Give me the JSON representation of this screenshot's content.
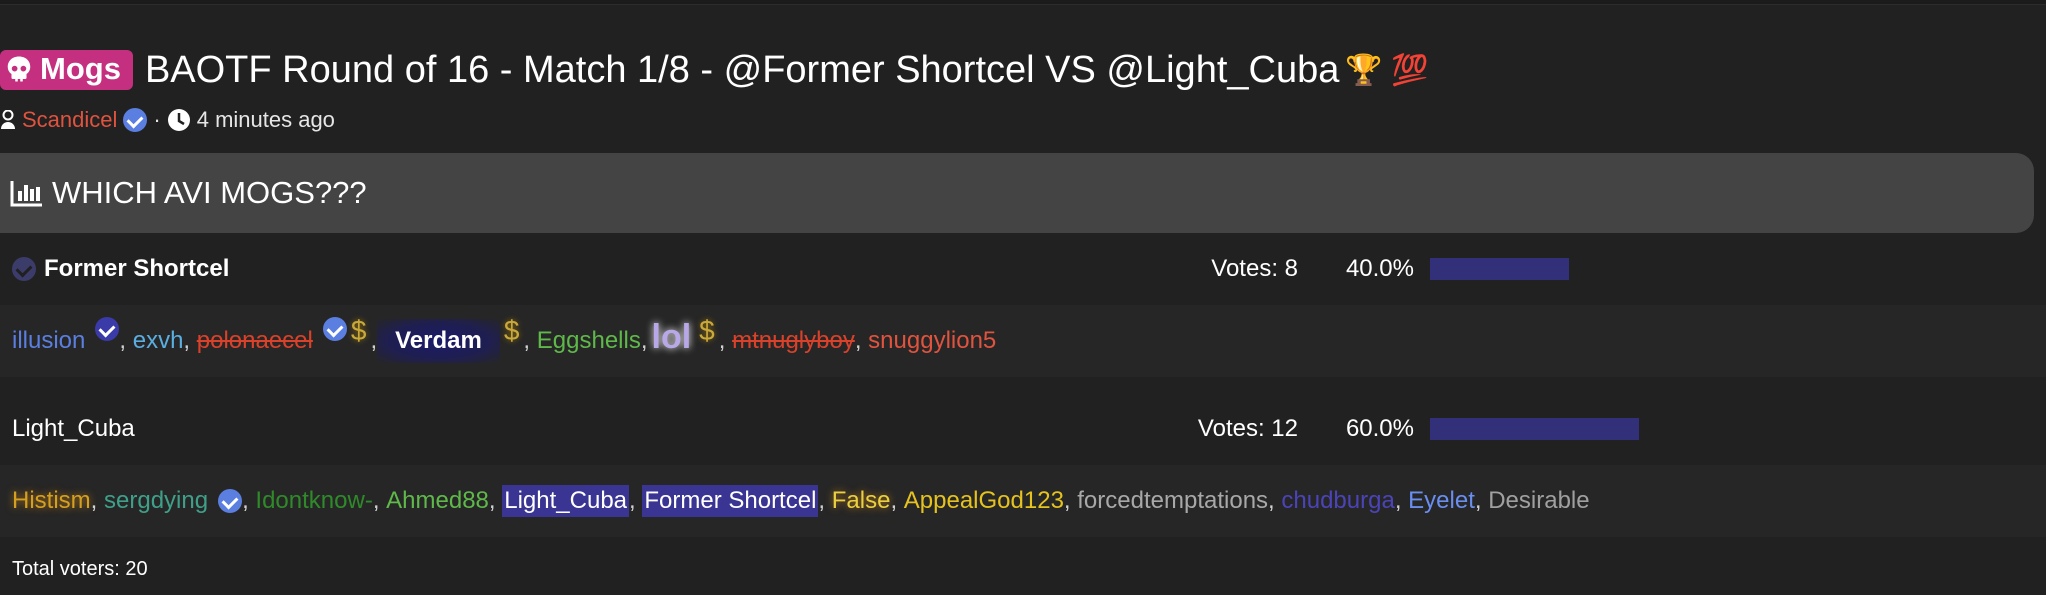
{
  "thread": {
    "tag_label": "Mogs",
    "title": "BAOTF Round of 16 - Match 1/8 - @Former Shortcel VS @Light_Cuba",
    "title_emojis": "🏆 💯",
    "author": "Scandicel",
    "separator": "·",
    "posted_ago": "4 minutes ago"
  },
  "poll": {
    "question": "WHICH AVI MOGS???",
    "options": [
      {
        "name": "Former Shortcel",
        "votes_label": "Votes: 8",
        "percent_label": "40.0%",
        "percent": 40.0
      },
      {
        "name": "Light_Cuba",
        "votes_label": "Votes: 12",
        "percent_label": "60.0%",
        "percent": 60.0
      }
    ],
    "voters_option1": {
      "v1": "illusion",
      "v2": "exvh",
      "v3": "polonaecel",
      "v3_badge": "$",
      "v4": "Verdam",
      "v4_badge": "$",
      "v5": "Eggshells",
      "v6": "lol",
      "v6_badge": "$",
      "v7": "mtnuglyboy",
      "v8": "snuggylion5"
    },
    "voters_option2": {
      "v1": "Histism",
      "v2": "sergdying",
      "v3": "Idontknow-",
      "v4": "Ahmed88",
      "v5": "Light_Cuba",
      "v6": "Former Shortcel",
      "v7": "False",
      "v8": "AppealGod123",
      "v9": "forcedtemptations",
      "v10": "chudburga",
      "v11": "Eyelet",
      "v12": "Desirable"
    },
    "comma": ",",
    "total_voters": "Total voters: 20"
  },
  "colors": {
    "background": "#212121",
    "tag_bg": "#c4307f",
    "poll_header_bg": "#444444",
    "bar_fill": "#33307a",
    "author": "#e0533f"
  }
}
